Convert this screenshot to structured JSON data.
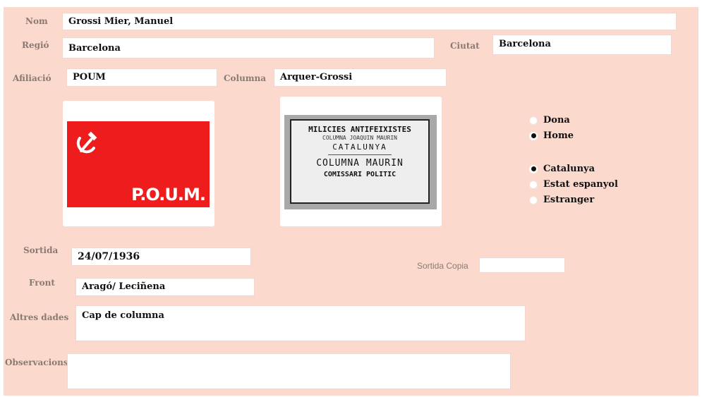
{
  "labels": {
    "nom": "Nom",
    "regio": "Regió",
    "ciutat": "Ciutat",
    "afiliacio": "Afiliació",
    "columna": "Columna",
    "sortida": "Sortida",
    "sortida_copia": "Sortida Copia",
    "front": "Front",
    "altres_dades": "Altres dades",
    "observacions": "Observacions"
  },
  "values": {
    "nom": "Grossi Mier, Manuel",
    "regio": "Barcelona",
    "ciutat": "Barcelona",
    "afiliacio": "POUM",
    "columna": "Arquer-Grossi",
    "sortida": "24/07/1936",
    "sortida_copia": "",
    "front": "Aragó/ Leciñena",
    "altres_dades": "Cap de columna",
    "observacions": ""
  },
  "images": {
    "poum_flag_text": "P.O.U.M.",
    "stamp": {
      "line1": "MILICIES ANTIFEIXISTES",
      "line2": "COLUMNA JOAQUIN MAURIN",
      "line3": "CATALUNYA",
      "line4": "COLUMNA MAURIN",
      "line5": "COMISSARI POLITIC"
    }
  },
  "gender": {
    "options": [
      {
        "label": "Dona",
        "selected": false
      },
      {
        "label": "Home",
        "selected": true
      }
    ]
  },
  "origin": {
    "options": [
      {
        "label": "Catalunya",
        "selected": true
      },
      {
        "label": "Estat espanyol",
        "selected": false
      },
      {
        "label": "Estranger",
        "selected": false
      }
    ]
  },
  "colors": {
    "panel_bg": "#fbd9cd",
    "flag_red": "#ee1c1c",
    "label_grey": "#8a7a74"
  }
}
